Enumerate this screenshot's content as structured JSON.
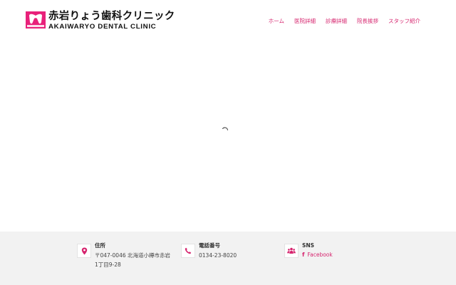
{
  "header": {
    "logo_title": "赤岩りょう歯科クリニック",
    "logo_subtitle": "AKAIWARYO DENTAL CLINIC",
    "nav": [
      {
        "label": "ホーム"
      },
      {
        "label": "医院詳細"
      },
      {
        "label": "診療詳細"
      },
      {
        "label": "院長挨拶"
      },
      {
        "label": "スタッフ紹介"
      }
    ]
  },
  "footer": {
    "address": {
      "label": "住所",
      "value": "〒047-0046 北海道小樽市赤岩1丁目9-28",
      "icon": "map-pin-icon"
    },
    "phone": {
      "label": "電話番号",
      "value": "0134-23-8020",
      "icon": "phone-icon"
    },
    "sns": {
      "label": "SNS",
      "link": "Facebook",
      "icon": "users-icon"
    }
  },
  "colors": {
    "accent": "#d6246e",
    "footer_bg": "#f2f2f2"
  }
}
